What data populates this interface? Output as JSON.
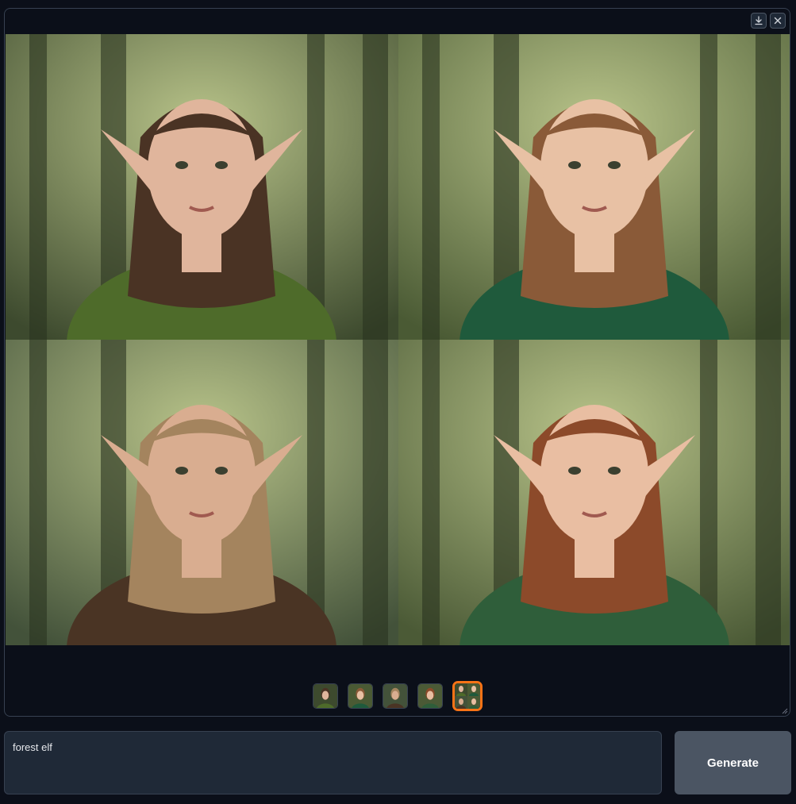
{
  "toolbar": {
    "download_icon": "download-icon",
    "close_icon": "close-icon"
  },
  "images": [
    {
      "alt": "elf-portrait-1",
      "bg": "#3d4a2e",
      "skin": "#e0b59c",
      "hair": "#4a3324",
      "cloth": "#4e6b2a"
    },
    {
      "alt": "elf-portrait-2",
      "bg": "#4a5a34",
      "skin": "#e8c1a4",
      "hair": "#8a5a38",
      "cloth": "#1f5a3c"
    },
    {
      "alt": "elf-portrait-3",
      "bg": "#43523a",
      "skin": "#d9ad90",
      "hair": "#a4845e",
      "cloth": "#4a3424"
    },
    {
      "alt": "elf-portrait-4",
      "bg": "#4b5a36",
      "skin": "#e9bea2",
      "hair": "#8c4a2a",
      "cloth": "#2f5e3a"
    }
  ],
  "thumbnails": [
    {
      "active": false
    },
    {
      "active": false
    },
    {
      "active": false
    },
    {
      "active": false
    },
    {
      "active": true
    }
  ],
  "prompt": {
    "value": "forest elf"
  },
  "generate_button": {
    "label": "Generate"
  },
  "colors": {
    "accent": "#f97316",
    "background": "#0b0f19",
    "panel": "#1f2937",
    "button": "#4b5563"
  }
}
